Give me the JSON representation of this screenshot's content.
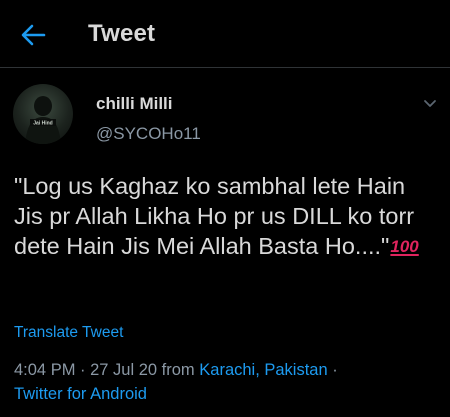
{
  "colors": {
    "background": "#000000",
    "text": "#d9d9d9",
    "secondary_text": "#8b98a5",
    "accent": "#1d9bf0",
    "emoji_red": "#e0245e"
  },
  "header": {
    "back_icon": "arrow-left-icon",
    "title": "Tweet"
  },
  "author": {
    "display_name": "chilli Milli",
    "handle": "@SYCOHo11",
    "avatar_text": "Jai Hind"
  },
  "tweet": {
    "text": "\"Log us Kaghaz ko sambhal lete Hain Jis pr Allah Likha Ho pr us DILL ko torr dete Hain Jis Mei Allah Basta Ho....\"",
    "emoji": "100"
  },
  "translate_label": "Translate Tweet",
  "meta": {
    "time": "4:04 PM",
    "separator": " · ",
    "date": "27 Jul 20",
    "from_label": " from ",
    "location": "Karachi, Pakistan",
    "separator2": " · ",
    "client": "Twitter for Android"
  }
}
